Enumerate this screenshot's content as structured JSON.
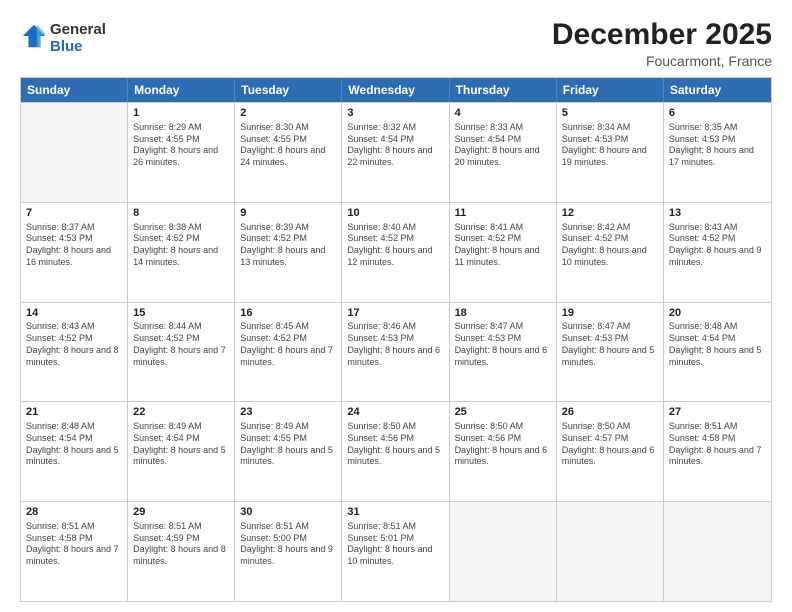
{
  "logo": {
    "general": "General",
    "blue": "Blue"
  },
  "title": "December 2025",
  "location": "Foucarmont, France",
  "header_days": [
    "Sunday",
    "Monday",
    "Tuesday",
    "Wednesday",
    "Thursday",
    "Friday",
    "Saturday"
  ],
  "weeks": [
    [
      {
        "day": "",
        "sunrise": "",
        "sunset": "",
        "daylight": "",
        "empty": true
      },
      {
        "day": "1",
        "sunrise": "Sunrise: 8:29 AM",
        "sunset": "Sunset: 4:55 PM",
        "daylight": "Daylight: 8 hours and 26 minutes."
      },
      {
        "day": "2",
        "sunrise": "Sunrise: 8:30 AM",
        "sunset": "Sunset: 4:55 PM",
        "daylight": "Daylight: 8 hours and 24 minutes."
      },
      {
        "day": "3",
        "sunrise": "Sunrise: 8:32 AM",
        "sunset": "Sunset: 4:54 PM",
        "daylight": "Daylight: 8 hours and 22 minutes."
      },
      {
        "day": "4",
        "sunrise": "Sunrise: 8:33 AM",
        "sunset": "Sunset: 4:54 PM",
        "daylight": "Daylight: 8 hours and 20 minutes."
      },
      {
        "day": "5",
        "sunrise": "Sunrise: 8:34 AM",
        "sunset": "Sunset: 4:53 PM",
        "daylight": "Daylight: 8 hours and 19 minutes."
      },
      {
        "day": "6",
        "sunrise": "Sunrise: 8:35 AM",
        "sunset": "Sunset: 4:53 PM",
        "daylight": "Daylight: 8 hours and 17 minutes."
      }
    ],
    [
      {
        "day": "7",
        "sunrise": "Sunrise: 8:37 AM",
        "sunset": "Sunset: 4:53 PM",
        "daylight": "Daylight: 8 hours and 16 minutes."
      },
      {
        "day": "8",
        "sunrise": "Sunrise: 8:38 AM",
        "sunset": "Sunset: 4:52 PM",
        "daylight": "Daylight: 8 hours and 14 minutes."
      },
      {
        "day": "9",
        "sunrise": "Sunrise: 8:39 AM",
        "sunset": "Sunset: 4:52 PM",
        "daylight": "Daylight: 8 hours and 13 minutes."
      },
      {
        "day": "10",
        "sunrise": "Sunrise: 8:40 AM",
        "sunset": "Sunset: 4:52 PM",
        "daylight": "Daylight: 8 hours and 12 minutes."
      },
      {
        "day": "11",
        "sunrise": "Sunrise: 8:41 AM",
        "sunset": "Sunset: 4:52 PM",
        "daylight": "Daylight: 8 hours and 11 minutes."
      },
      {
        "day": "12",
        "sunrise": "Sunrise: 8:42 AM",
        "sunset": "Sunset: 4:52 PM",
        "daylight": "Daylight: 8 hours and 10 minutes."
      },
      {
        "day": "13",
        "sunrise": "Sunrise: 8:43 AM",
        "sunset": "Sunset: 4:52 PM",
        "daylight": "Daylight: 8 hours and 9 minutes."
      }
    ],
    [
      {
        "day": "14",
        "sunrise": "Sunrise: 8:43 AM",
        "sunset": "Sunset: 4:52 PM",
        "daylight": "Daylight: 8 hours and 8 minutes."
      },
      {
        "day": "15",
        "sunrise": "Sunrise: 8:44 AM",
        "sunset": "Sunset: 4:52 PM",
        "daylight": "Daylight: 8 hours and 7 minutes."
      },
      {
        "day": "16",
        "sunrise": "Sunrise: 8:45 AM",
        "sunset": "Sunset: 4:52 PM",
        "daylight": "Daylight: 8 hours and 7 minutes."
      },
      {
        "day": "17",
        "sunrise": "Sunrise: 8:46 AM",
        "sunset": "Sunset: 4:53 PM",
        "daylight": "Daylight: 8 hours and 6 minutes."
      },
      {
        "day": "18",
        "sunrise": "Sunrise: 8:47 AM",
        "sunset": "Sunset: 4:53 PM",
        "daylight": "Daylight: 8 hours and 6 minutes."
      },
      {
        "day": "19",
        "sunrise": "Sunrise: 8:47 AM",
        "sunset": "Sunset: 4:53 PM",
        "daylight": "Daylight: 8 hours and 5 minutes."
      },
      {
        "day": "20",
        "sunrise": "Sunrise: 8:48 AM",
        "sunset": "Sunset: 4:54 PM",
        "daylight": "Daylight: 8 hours and 5 minutes."
      }
    ],
    [
      {
        "day": "21",
        "sunrise": "Sunrise: 8:48 AM",
        "sunset": "Sunset: 4:54 PM",
        "daylight": "Daylight: 8 hours and 5 minutes."
      },
      {
        "day": "22",
        "sunrise": "Sunrise: 8:49 AM",
        "sunset": "Sunset: 4:54 PM",
        "daylight": "Daylight: 8 hours and 5 minutes."
      },
      {
        "day": "23",
        "sunrise": "Sunrise: 8:49 AM",
        "sunset": "Sunset: 4:55 PM",
        "daylight": "Daylight: 8 hours and 5 minutes."
      },
      {
        "day": "24",
        "sunrise": "Sunrise: 8:50 AM",
        "sunset": "Sunset: 4:56 PM",
        "daylight": "Daylight: 8 hours and 5 minutes."
      },
      {
        "day": "25",
        "sunrise": "Sunrise: 8:50 AM",
        "sunset": "Sunset: 4:56 PM",
        "daylight": "Daylight: 8 hours and 6 minutes."
      },
      {
        "day": "26",
        "sunrise": "Sunrise: 8:50 AM",
        "sunset": "Sunset: 4:57 PM",
        "daylight": "Daylight: 8 hours and 6 minutes."
      },
      {
        "day": "27",
        "sunrise": "Sunrise: 8:51 AM",
        "sunset": "Sunset: 4:58 PM",
        "daylight": "Daylight: 8 hours and 7 minutes."
      }
    ],
    [
      {
        "day": "28",
        "sunrise": "Sunrise: 8:51 AM",
        "sunset": "Sunset: 4:58 PM",
        "daylight": "Daylight: 8 hours and 7 minutes."
      },
      {
        "day": "29",
        "sunrise": "Sunrise: 8:51 AM",
        "sunset": "Sunset: 4:59 PM",
        "daylight": "Daylight: 8 hours and 8 minutes."
      },
      {
        "day": "30",
        "sunrise": "Sunrise: 8:51 AM",
        "sunset": "Sunset: 5:00 PM",
        "daylight": "Daylight: 8 hours and 9 minutes."
      },
      {
        "day": "31",
        "sunrise": "Sunrise: 8:51 AM",
        "sunset": "Sunset: 5:01 PM",
        "daylight": "Daylight: 8 hours and 10 minutes."
      },
      {
        "day": "",
        "sunrise": "",
        "sunset": "",
        "daylight": "",
        "empty": true
      },
      {
        "day": "",
        "sunrise": "",
        "sunset": "",
        "daylight": "",
        "empty": true
      },
      {
        "day": "",
        "sunrise": "",
        "sunset": "",
        "daylight": "",
        "empty": true
      }
    ]
  ]
}
